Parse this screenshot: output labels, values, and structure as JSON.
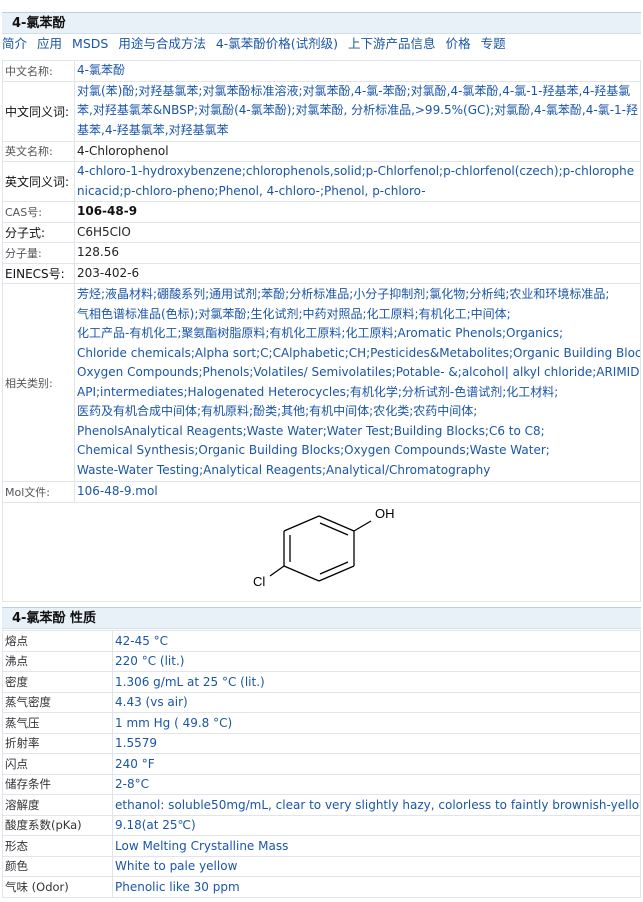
{
  "title": "4-氯苯酚",
  "nav": [
    "简介",
    "应用",
    "MSDS",
    "用途与合成方法",
    "4-氯苯酚价格(试剂级)",
    "上下游产品信息",
    "价格",
    "专题"
  ],
  "info": {
    "cn_name_label": "中文名称:",
    "cn_name": "4-氯苯酚",
    "cn_syn_label": "中文同义词:",
    "cn_syn": "对氯(苯)酚;对羟基氯苯;对氯苯酚标准溶液;对氯苯酚,4-氯-苯酚;对氯酚,4-氯苯酚,4-氯-1-羟基苯,4-羟基氯苯,对羟基氯苯&NBSP;对氯酚(4-氯苯酚);对氯苯酚, 分析标准品,>99.5%(GC);对氯酚,4-氯苯酚,4-氯-1-羟基苯,4-羟基氯苯,对羟基氯苯",
    "en_name_label": "英文名称:",
    "en_name": "4-Chlorophenol",
    "en_syn_label": "英文同义词:",
    "en_syn": "4-chloro-1-hydroxybenzene;chlorophenols,solid;p-Chlorfenol;p-chlorfenol(czech);p-chlorophenicacid;p-chloro-pheno;Phenol, 4-chloro-;Phenol, p-chloro-",
    "cas_label": "CAS号:",
    "cas": "106-48-9",
    "formula_label": "分子式:",
    "formula": "C6H5ClO",
    "mw_label": "分子量:",
    "mw": "128.56",
    "einecs_label": "EINECS号:",
    "einecs": "203-402-6",
    "cat_label": "相关类别:",
    "categories": [
      "芳烃;液晶材料;硼酸系列;通用试剂;苯酚;分析标准品;小分子抑制剂;氯化物;分析纯;农业和环境标准品;",
      "气相色谱标准品(色标);对氯苯酚;生化试剂;中药对照品;化工原料;有机化工;中间体;",
      "化工产品-有机化工;聚氨酯树脂原料;有机化工原料;化工原料;Aromatic Phenols;Organics;",
      "Chloride chemicals;Alpha sort;C;CAlphabetic;CH;Pesticides&Metabolites;Organic Building Blocks;",
      "Oxygen Compounds;Phenols;Volatiles/ Semivolatiles;Potable- &;alcohol| alkyl chloride;ARIMIDEX;",
      "API;intermediates;Halogenated Heterocycles;有机化学;分析试剂-色谱试剂;化工材料;",
      "医药及有机合成中间体;有机原料;酚类;其他;有机中间体;农化类;农药中间体;",
      "PhenolsAnalytical Reagents;Waste Water;Water Test;Building Blocks;C6 to C8;",
      "Chemical Synthesis;Organic Building Blocks;Oxygen Compounds;Waste Water;",
      "Waste-Water Testing;Analytical Reagents;Analytical/Chromatography"
    ],
    "mol_label": "Mol文件:",
    "mol": "106-48-9.mol",
    "structure": {
      "oh": "OH",
      "cl": "Cl"
    }
  },
  "props_title": "4-氯苯酚 性质",
  "props": [
    {
      "label": "熔点",
      "value": "42-45 °C"
    },
    {
      "label": "沸点",
      "value": "220 °C (lit.)"
    },
    {
      "label": "密度",
      "value": "1.306 g/mL at 25 °C (lit.)"
    },
    {
      "label": "蒸气密度",
      "value": "4.43 (vs air)"
    },
    {
      "label": "蒸气压",
      "value": "1 mm Hg ( 49.8 °C)"
    },
    {
      "label": "折射率",
      "value": "1.5579"
    },
    {
      "label": "闪点",
      "value": "240 °F"
    },
    {
      "label": "储存条件",
      "value": "2-8°C"
    },
    {
      "label": "溶解度",
      "value": "ethanol: soluble50mg/mL, clear to very slightly hazy, colorless to faintly brownish-yellow"
    },
    {
      "label": "酸度系数(pKa)",
      "value": "9.18(at 25℃)"
    },
    {
      "label": "形态",
      "value": "Low Melting Crystalline Mass"
    },
    {
      "label": "颜色",
      "value": "White to pale yellow"
    },
    {
      "label": "气味 (Odor)",
      "value": "Phenolic like 30 ppm"
    }
  ]
}
